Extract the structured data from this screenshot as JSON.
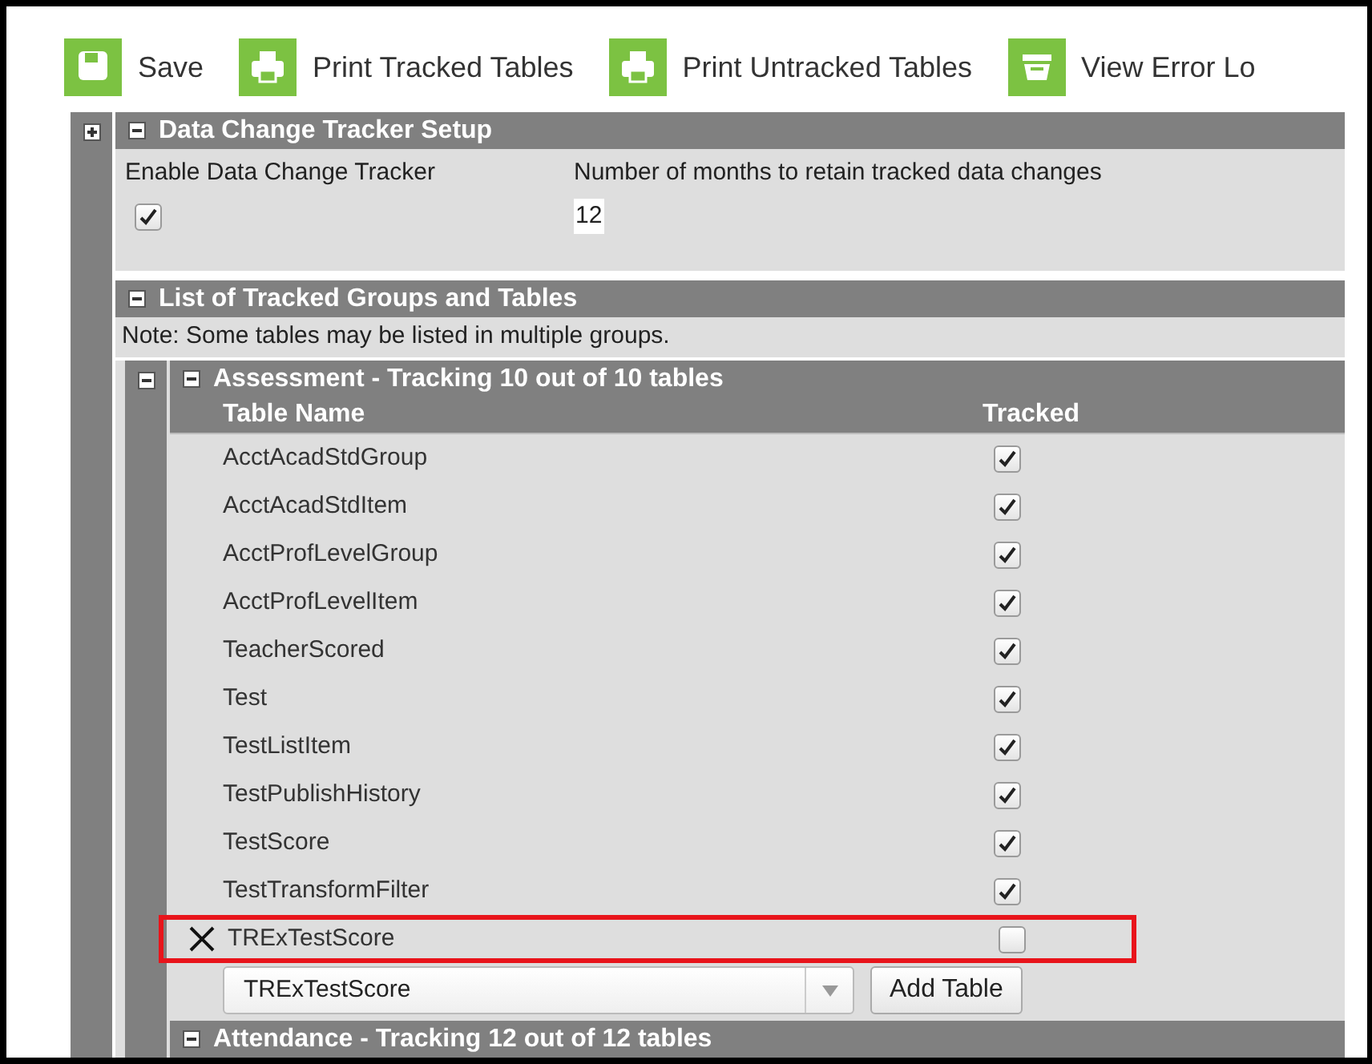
{
  "toolbar": [
    {
      "label": "Save",
      "kind": "save"
    },
    {
      "label": "Print Tracked Tables",
      "kind": "print"
    },
    {
      "label": "Print Untracked Tables",
      "kind": "print"
    },
    {
      "label": "View Error Lo",
      "kind": "log"
    }
  ],
  "setup": {
    "title": "Data Change Tracker Setup",
    "enable_label": "Enable Data Change Tracker",
    "enable_checked": true,
    "months_label": "Number of months to retain tracked data changes",
    "months_value": "12"
  },
  "list": {
    "title": "List of Tracked Groups and Tables",
    "note": "Note: Some tables may be listed in multiple groups.",
    "groups": [
      {
        "title": "Assessment - Tracking 10 out of 10 tables",
        "columns": [
          "Table Name",
          "Tracked"
        ],
        "rows": [
          {
            "name": "AcctAcadStdGroup",
            "tracked": true,
            "removable": false,
            "highlighted": false
          },
          {
            "name": "AcctAcadStdItem",
            "tracked": true,
            "removable": false,
            "highlighted": false
          },
          {
            "name": "AcctProfLevelGroup",
            "tracked": true,
            "removable": false,
            "highlighted": false
          },
          {
            "name": "AcctProfLevelItem",
            "tracked": true,
            "removable": false,
            "highlighted": false
          },
          {
            "name": "TeacherScored",
            "tracked": true,
            "removable": false,
            "highlighted": false
          },
          {
            "name": "Test",
            "tracked": true,
            "removable": false,
            "highlighted": false
          },
          {
            "name": "TestListItem",
            "tracked": true,
            "removable": false,
            "highlighted": false
          },
          {
            "name": "TestPublishHistory",
            "tracked": true,
            "removable": false,
            "highlighted": false
          },
          {
            "name": "TestScore",
            "tracked": true,
            "removable": false,
            "highlighted": false
          },
          {
            "name": "TestTransformFilter",
            "tracked": true,
            "removable": false,
            "highlighted": false
          },
          {
            "name": "TRExTestScore",
            "tracked": false,
            "removable": true,
            "highlighted": true
          }
        ],
        "add_select": "TRExTestScore",
        "add_button": "Add Table"
      },
      {
        "title": "Attendance - Tracking 12 out of 12 tables"
      }
    ]
  }
}
